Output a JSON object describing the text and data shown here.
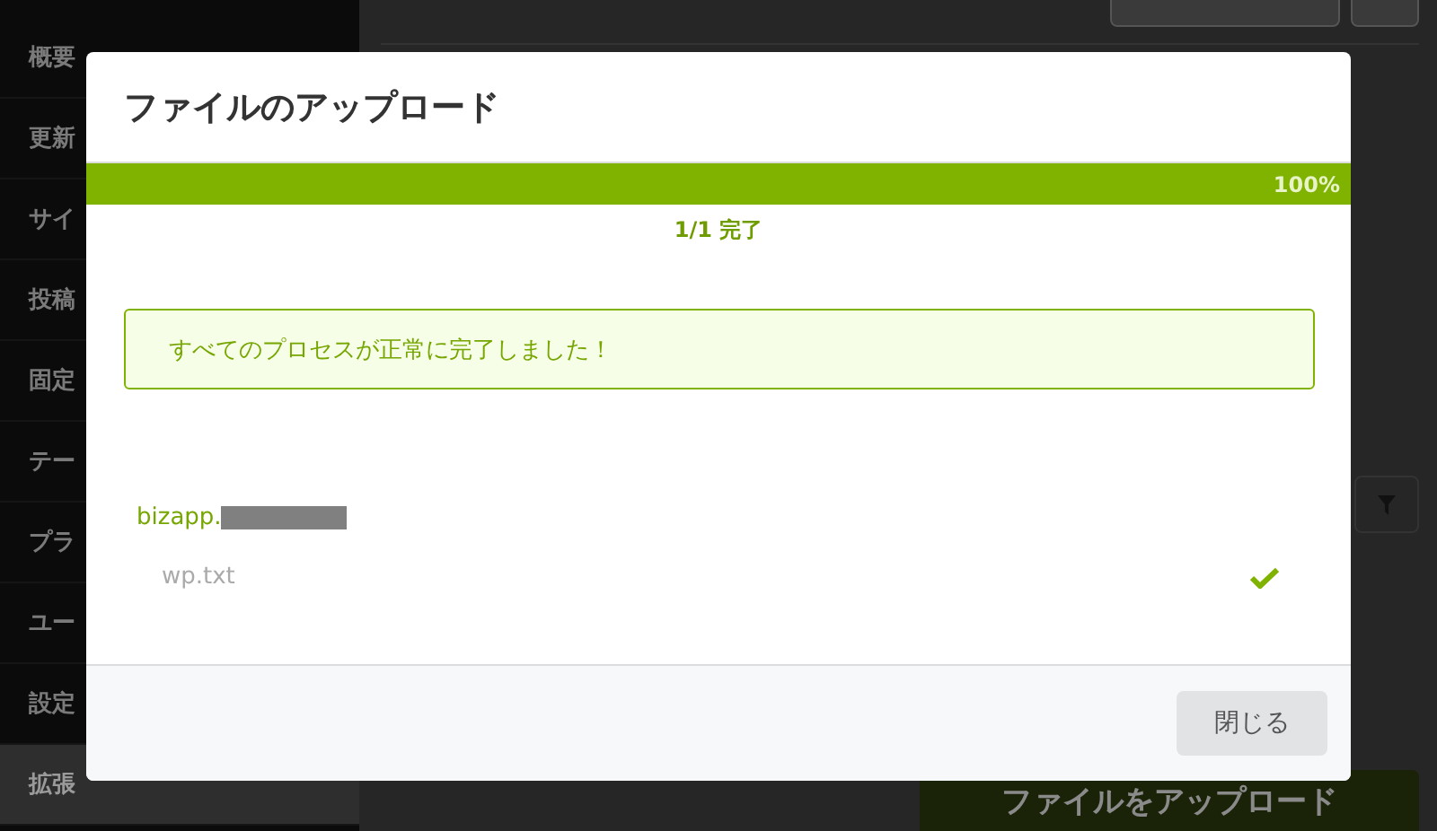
{
  "sidebar": {
    "items": [
      {
        "label": "概要",
        "selected": false
      },
      {
        "label": "更新",
        "selected": false
      },
      {
        "label": "サイ",
        "selected": false
      },
      {
        "label": "投稿",
        "selected": false
      },
      {
        "label": "固定",
        "selected": false
      },
      {
        "label": "テー",
        "selected": false
      },
      {
        "label": "プラ",
        "selected": false
      },
      {
        "label": "ユー",
        "selected": false
      },
      {
        "label": "設定",
        "selected": false
      },
      {
        "label": "拡張",
        "selected": true
      }
    ]
  },
  "main": {
    "upload_button": "ファイルをアップロード"
  },
  "dialog": {
    "title": "ファイルのアップロード",
    "progress": {
      "level": 1,
      "percent": "100%"
    },
    "status": "1/1 完了",
    "alert": "すべてのプロセスが正常に完了しました！",
    "group": {
      "name": "bizapp.",
      "redacted": true,
      "files": [
        {
          "name": "wp.txt",
          "done": true
        }
      ]
    },
    "close_button": "閉じる"
  }
}
